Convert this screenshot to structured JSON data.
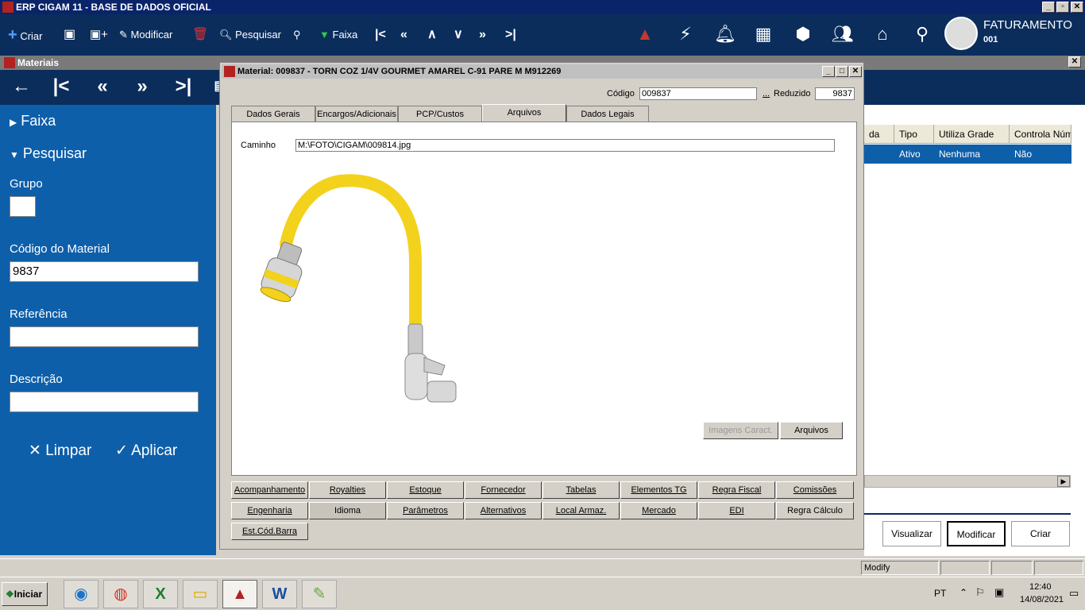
{
  "app": {
    "title": "ERP CIGAM 11 - BASE DE DADOS OFICIAL",
    "window_buttons": [
      "_",
      "▫",
      "✕"
    ]
  },
  "toolbar": {
    "criar": "Criar",
    "modificar": "Modificar",
    "pesquisar": "Pesquisar",
    "faixa": "Faixa",
    "module_title": "FATURAMENTO",
    "module_code": "001"
  },
  "materiais": {
    "title": "Materiais"
  },
  "sidebar": {
    "faixa": "Faixa",
    "pesquisar": "Pesquisar",
    "grupo_label": "Grupo",
    "grupo_value": "",
    "codigo_label": "Código do Material",
    "codigo_value": "9837",
    "referencia_label": "Referência",
    "referencia_value": "",
    "descricao_label": "Descrição",
    "descricao_value": "",
    "limpar": "Limpar",
    "aplicar": "Aplicar"
  },
  "grid": {
    "headers": [
      "da",
      "Tipo",
      "Utiliza Grade",
      "Controla Núme"
    ],
    "row": [
      "",
      "Ativo",
      "Nenhuma",
      "Não"
    ]
  },
  "right_buttons": {
    "visualizar": "Visualizar",
    "modificar": "Modificar",
    "criar": "Criar"
  },
  "dialog": {
    "title": "Material: 009837 - TORN COZ 1/4V GOURMET AMAREL C-91 PARE M M912269",
    "codigo_label": "Código",
    "codigo_value": "009837",
    "ellipsis": "...",
    "reduzido_label": "Reduzido",
    "reduzido_value": "9837",
    "tabs": [
      "Dados Gerais",
      "Encargos/Adicionais",
      "PCP/Custos",
      "Arquivos",
      "Dados Legais"
    ],
    "caminho_label": "Caminho",
    "caminho_value": "M:\\FOTO\\CIGAM\\009814.jpg",
    "imagens_btn": "Imagens Caract.",
    "arquivos_btn": "Arquivos",
    "bottom_row1": [
      "Acompanhamento",
      "Royalties",
      "Estoque",
      "Fornecedor",
      "Tabelas",
      "Elementos TG",
      "Regra Fiscal",
      "Comissões"
    ],
    "bottom_row2": [
      "Engenharia",
      "Idioma",
      "Parâmetros",
      "Alternativos",
      "Local Armaz.",
      "Mercado",
      "EDI",
      "Regra Cálculo"
    ],
    "bottom_row3": [
      "Est.Cód.Barra"
    ]
  },
  "statusbar": {
    "mode": "Modify"
  },
  "taskbar": {
    "start": "Iniciar",
    "lang": "PT",
    "time": "12:40",
    "date": "14/08/2021"
  },
  "colors": {
    "navy": "#0b2d5c",
    "sidebar_blue": "#0e5faa",
    "faucet_yellow": "#f2d21c"
  }
}
